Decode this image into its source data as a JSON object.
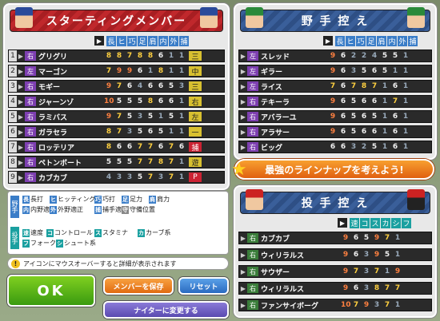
{
  "colors": {
    "hitter_pos": "#7d3fb0",
    "pitcher_pos": "#3a7d3a",
    "accent": "#e8a020"
  },
  "starting": {
    "title": "スターティングメンバー",
    "cols": [
      {
        "t": "長",
        "c": "#3a7dc8"
      },
      {
        "t": "ヒ",
        "c": "#3a7dc8"
      },
      {
        "t": "巧",
        "c": "#3a7dc8"
      },
      {
        "t": "足",
        "c": "#3a7dc8"
      },
      {
        "t": "肩",
        "c": "#3a7dc8"
      },
      {
        "t": "内",
        "c": "#3a7dc8"
      },
      {
        "t": "外",
        "c": "#3a7dc8"
      },
      {
        "t": "捕",
        "c": "#3a7dc8"
      }
    ],
    "rows": [
      {
        "n": "1",
        "p": "右",
        "nm": "グリグリ",
        "s": [
          "8",
          "8",
          "7",
          "8",
          "8",
          "6",
          "1",
          "1"
        ],
        "f": "三"
      },
      {
        "n": "2",
        "p": "左",
        "nm": "マーゴン",
        "s": [
          "7",
          "9",
          "9",
          "6",
          "1",
          "8",
          "1",
          "1"
        ],
        "f": "中"
      },
      {
        "n": "3",
        "p": "右",
        "nm": "モギー",
        "s": [
          "9",
          "7",
          "6",
          "4",
          "6",
          "6",
          "5",
          "3"
        ],
        "f": "三"
      },
      {
        "n": "4",
        "p": "右",
        "nm": "ジャーンゾ",
        "s": [
          "10",
          "5",
          "5",
          "5",
          "8",
          "6",
          "6",
          "1"
        ],
        "f": "右"
      },
      {
        "n": "5",
        "p": "右",
        "nm": "ラミバス",
        "s": [
          "9",
          "7",
          "5",
          "3",
          "5",
          "1",
          "5",
          "1"
        ],
        "f": "左"
      },
      {
        "n": "6",
        "p": "右",
        "nm": "ガラセラ",
        "s": [
          "8",
          "7",
          "3",
          "5",
          "6",
          "5",
          "1",
          "1"
        ],
        "f": "一"
      },
      {
        "n": "7",
        "p": "右",
        "nm": "ロッテリア",
        "s": [
          "8",
          "6",
          "6",
          "7",
          "7",
          "6",
          "7",
          "6"
        ],
        "f": "捕"
      },
      {
        "n": "8",
        "p": "右",
        "nm": "ペトンボート",
        "s": [
          "5",
          "5",
          "5",
          "7",
          "7",
          "8",
          "7",
          "1"
        ],
        "f": "遊"
      },
      {
        "n": "9",
        "p": "右",
        "nm": "カブカブ",
        "s": [
          "4",
          "3",
          "3",
          "5",
          "7",
          "3",
          "7",
          "1"
        ],
        "f": "P"
      }
    ]
  },
  "bench": {
    "title": "野 手 控 え",
    "rows": [
      {
        "p": "左",
        "nm": "スレッド",
        "s": [
          "9",
          "6",
          "2",
          "2",
          "4",
          "5",
          "5",
          "1"
        ]
      },
      {
        "p": "左",
        "nm": "ギラー",
        "s": [
          "9",
          "6",
          "3",
          "5",
          "6",
          "5",
          "1",
          "1"
        ]
      },
      {
        "p": "左",
        "nm": "ライス",
        "s": [
          "7",
          "6",
          "7",
          "8",
          "7",
          "1",
          "6",
          "1"
        ]
      },
      {
        "p": "右",
        "nm": "テキーラ",
        "s": [
          "9",
          "6",
          "5",
          "6",
          "6",
          "1",
          "7",
          "1"
        ]
      },
      {
        "p": "右",
        "nm": "アバラーユ",
        "s": [
          "9",
          "6",
          "5",
          "6",
          "5",
          "1",
          "6",
          "1"
        ]
      },
      {
        "p": "右",
        "nm": "アラサー",
        "s": [
          "9",
          "6",
          "5",
          "6",
          "6",
          "1",
          "6",
          "1"
        ]
      },
      {
        "p": "右",
        "nm": "ビッグ",
        "s": [
          "6",
          "6",
          "3",
          "2",
          "5",
          "1",
          "6",
          "1"
        ]
      }
    ]
  },
  "banner": "最強のラインナップを考えよう!",
  "relief": {
    "title": "投 手 控 え",
    "cols": [
      {
        "t": "速",
        "c": "#1aa0a0"
      },
      {
        "t": "コ",
        "c": "#1aa0a0"
      },
      {
        "t": "ス",
        "c": "#1aa0a0"
      },
      {
        "t": "カ",
        "c": "#1aa0a0"
      },
      {
        "t": "シ",
        "c": "#1aa0a0"
      },
      {
        "t": "フ",
        "c": "#1aa0a0"
      }
    ],
    "rows": [
      {
        "p": "右",
        "nm": "カブカブ",
        "s": [
          "9",
          "6",
          "5",
          "9",
          "7",
          "1"
        ]
      },
      {
        "p": "右",
        "nm": "ウィリラルス",
        "s": [
          "9",
          "6",
          "3",
          "9",
          "5",
          "1"
        ]
      },
      {
        "p": "右",
        "nm": "サウザー",
        "s": [
          "9",
          "7",
          "3",
          "7",
          "1",
          "9"
        ]
      },
      {
        "p": "右",
        "nm": "ウィリラルス",
        "s": [
          "9",
          "6",
          "3",
          "8",
          "7",
          "7"
        ]
      },
      {
        "p": "右",
        "nm": "ファンサイボーグ",
        "s": [
          "10",
          "7",
          "9",
          "3",
          "7",
          "1"
        ]
      }
    ]
  },
  "legend": {
    "fielder_tag": "野手",
    "pitcher_tag": "投手",
    "items": [
      {
        "k": "長",
        "t": "長打"
      },
      {
        "k": "ヒ",
        "t": "ヒッティング"
      },
      {
        "k": "巧",
        "t": "巧打"
      },
      {
        "k": "足",
        "t": "足力"
      },
      {
        "k": "肩",
        "t": "肩力"
      },
      {
        "k": "内",
        "t": "内野適正"
      },
      {
        "k": "外",
        "t": "外野適正"
      },
      {
        "k": "捕",
        "t": "捕手適正"
      },
      {
        "k": "守",
        "t": "守備位置"
      },
      {
        "k": "速",
        "t": "速度"
      },
      {
        "k": "コ",
        "t": "コントロール"
      },
      {
        "k": "ス",
        "t": "スタミナ"
      },
      {
        "k": "カ",
        "t": "カーブ系"
      },
      {
        "k": "フ",
        "t": "フォーク系"
      },
      {
        "k": "シ",
        "t": "シュート系"
      }
    ]
  },
  "hint": "アイコンにマウスオーバーすると詳細が表示されます",
  "buttons": {
    "ok": "OK",
    "save": "メンバーを保存",
    "reset": "リセット",
    "night": "ナイターに変更する"
  }
}
